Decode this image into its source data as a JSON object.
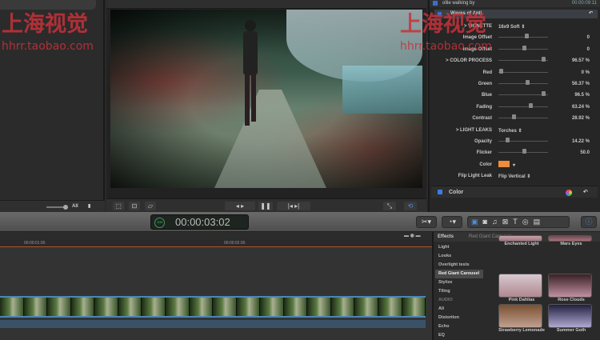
{
  "watermark": {
    "chars": "上海视觉",
    "url": "hhrr.taobao.com"
  },
  "browser": {
    "filter_label": "All"
  },
  "inspector": {
    "clip_name": "ollie walking by",
    "clip_duration": "00:00:09:11",
    "effect_name": "Waves of Anti",
    "rows": [
      {
        "label": "> VIGNETTE",
        "text": "16x9 Soft"
      },
      {
        "label": "Image Offset",
        "value": "0",
        "pos": 0.55
      },
      {
        "label": "Image Offset",
        "value": "0",
        "pos": 0.5
      },
      {
        "label": "> COLOR PROCESS",
        "value": "96.57 %",
        "pos": 0.9
      },
      {
        "label": "Red",
        "value": "0 %",
        "pos": 0.02
      },
      {
        "label": "Green",
        "value": "56.37 %",
        "pos": 0.56
      },
      {
        "label": "Blue",
        "value": "96.5 %",
        "pos": 0.9
      },
      {
        "label": "Fading",
        "value": "63.24 %",
        "pos": 0.63
      },
      {
        "label": "Contrast",
        "value": "28.92 %",
        "pos": 0.29
      },
      {
        "label": "> LIGHT LEAKS",
        "text": "Torches"
      },
      {
        "label": "Opacity",
        "value": "14.22 %",
        "pos": 0.15
      },
      {
        "label": "Flicker",
        "value": "50.0",
        "pos": 0.5
      },
      {
        "label": "Color",
        "swatch": "#f08c3c"
      },
      {
        "label": "Flip Light Leak",
        "text": "Flip Vertical"
      }
    ],
    "color_section": "Color"
  },
  "timecode": {
    "display": "00:00:03:02",
    "short": "3:02",
    "ring": "100"
  },
  "timeline": {
    "ruler": [
      "00:00:01:00",
      "00:00:02:00"
    ]
  },
  "effects": {
    "title": "Effects",
    "collection": "Red Giant Carousel",
    "categories": [
      {
        "label": "Light"
      },
      {
        "label": "Looks"
      },
      {
        "label": "Overlight tests"
      },
      {
        "label": "Red Giant Carousel",
        "selected": true
      },
      {
        "label": "Stylize"
      },
      {
        "label": "Tiling"
      },
      {
        "label": "AUDIO",
        "dim": true
      },
      {
        "label": "All"
      },
      {
        "label": "Distortion"
      },
      {
        "label": "Echo"
      },
      {
        "label": "EQ"
      }
    ],
    "items": [
      "Enchanted Light",
      "Mars Eyes",
      "Pink Dahlias",
      "Rose Clouds",
      "Strawberry Lemonade",
      "Summer Goth"
    ]
  }
}
